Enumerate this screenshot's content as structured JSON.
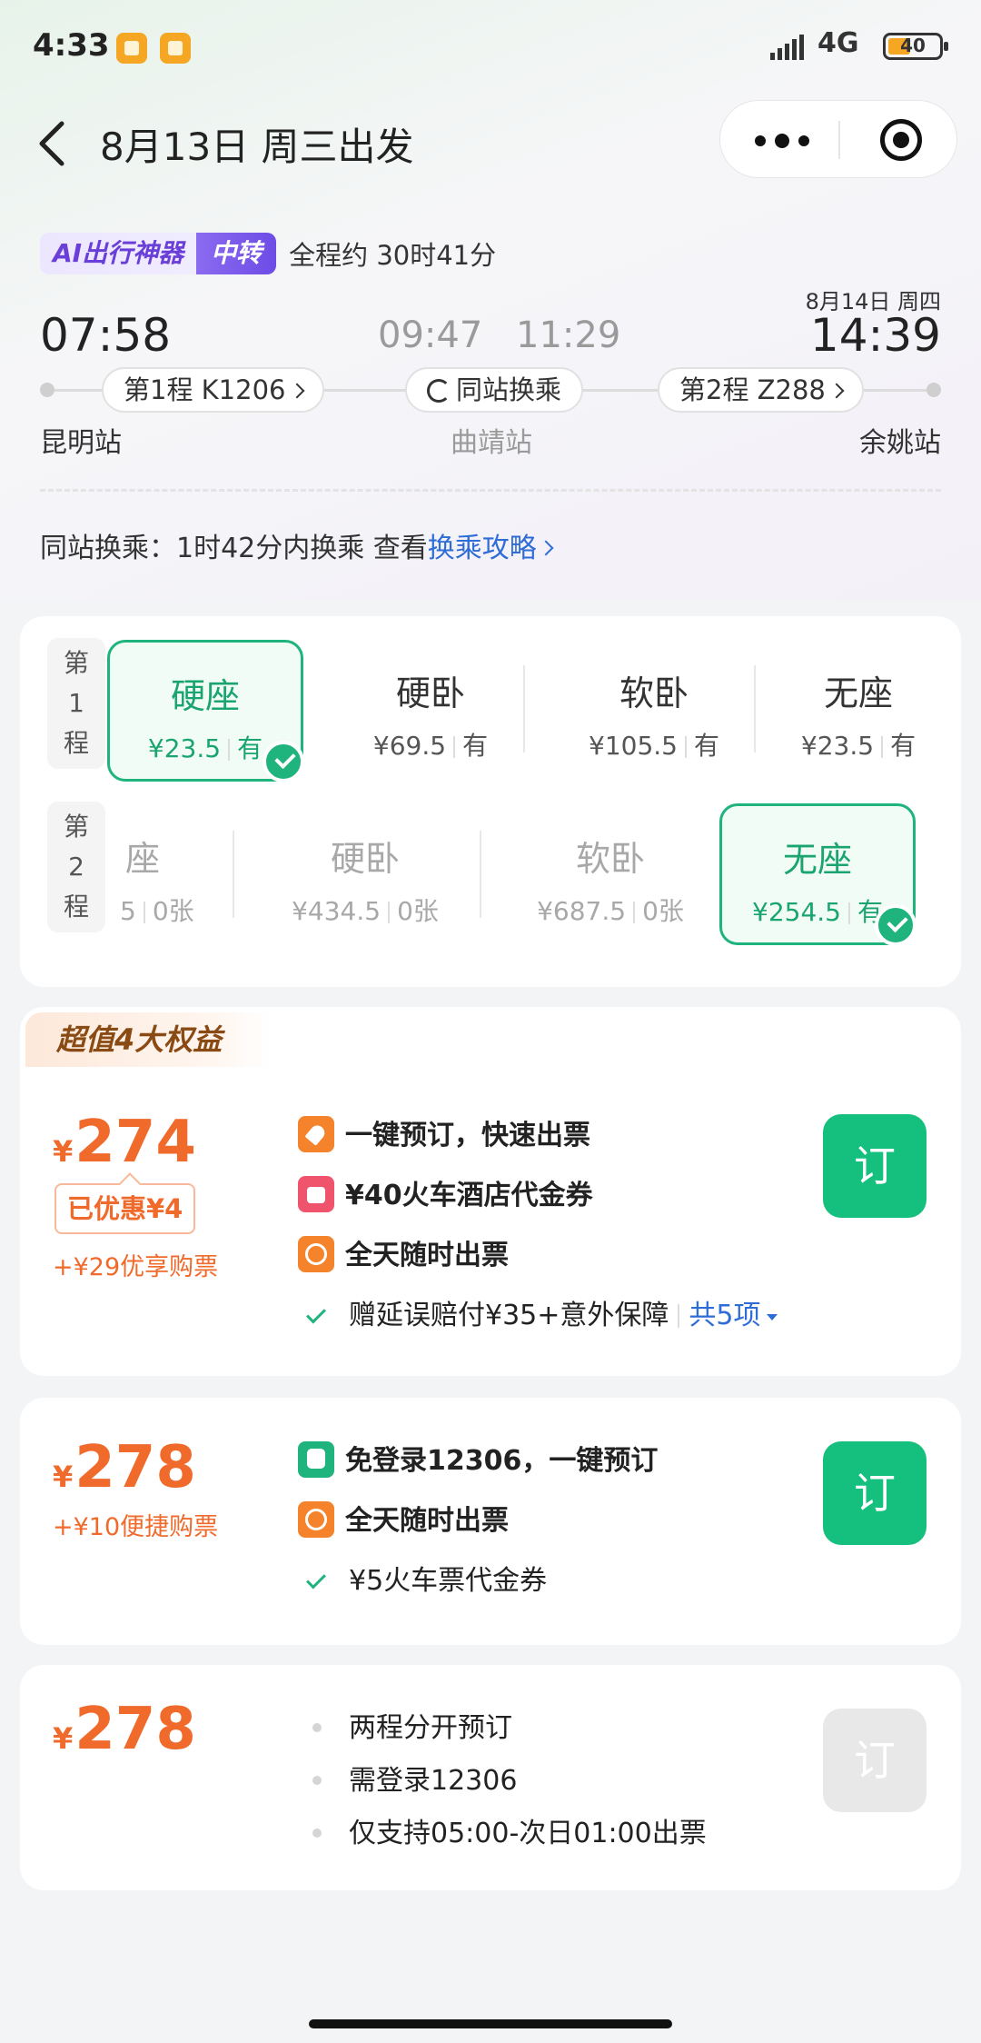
{
  "status_bar": {
    "time": "4:33",
    "network": "4G",
    "battery": "40"
  },
  "header": {
    "title": "8月13日 周三出发"
  },
  "journey": {
    "ai_tag": "AI出行神器",
    "transfer_tag": "中转",
    "duration": "全程约 30时41分",
    "depart_time": "07:58",
    "mid_arrive_time": "09:47",
    "mid_depart_time": "11:29",
    "arrive_date": "8月14日 周四",
    "arrive_time": "14:39",
    "leg1_label": "第1程  K1206",
    "transfer_label": "同站换乘",
    "leg2_label": "第2程  Z288",
    "depart_station": "昆明站",
    "mid_station": "曲靖站",
    "arrive_station": "余姚站",
    "transfer_info": "同站换乘：1时42分内换乘  查看",
    "transfer_link": "换乘攻略"
  },
  "seats": {
    "leg1_label": [
      "第",
      "1",
      "程"
    ],
    "leg2_label": [
      "第",
      "2",
      "程"
    ],
    "leg1": [
      {
        "name": "硬座",
        "price": "¥23.5",
        "avail": "有"
      },
      {
        "name": "硬卧",
        "price": "¥69.5",
        "avail": "有"
      },
      {
        "name": "软卧",
        "price": "¥105.5",
        "avail": "有"
      },
      {
        "name": "无座",
        "price": "¥23.5",
        "avail": "有"
      }
    ],
    "leg2": [
      {
        "name": "座",
        "price": "5",
        "avail": "0张"
      },
      {
        "name": "硬卧",
        "price": "¥434.5",
        "avail": "0张"
      },
      {
        "name": "软卧",
        "price": "¥687.5",
        "avail": "0张"
      },
      {
        "name": "无座",
        "price": "¥254.5",
        "avail": "有"
      }
    ]
  },
  "offers": [
    {
      "tag": "超值4大权益",
      "yen": "¥",
      "price": "274",
      "discount": "已优惠¥4",
      "sub": "+¥29优享购票",
      "features": [
        "一键预订，快速出票",
        "¥40火车酒店代金券",
        "全天随时出票"
      ],
      "extra": "赠延误赔付¥35+意外保障",
      "more": "共5项",
      "button": "订"
    },
    {
      "yen": "¥",
      "price": "278",
      "sub": "+¥10便捷购票",
      "features": [
        "免登录12306，一键预订",
        "全天随时出票"
      ],
      "extra": "¥5火车票代金券",
      "button": "订"
    },
    {
      "yen": "¥",
      "price": "278",
      "features": [
        "两程分开预订",
        "需登录12306",
        "仅支持05:00-次日01:00出票"
      ],
      "button": "订"
    }
  ],
  "colors": {
    "accent": "#1fb37d",
    "price": "#f06a2b",
    "link": "#2e6cd6",
    "ai": "#6a3fd8"
  }
}
